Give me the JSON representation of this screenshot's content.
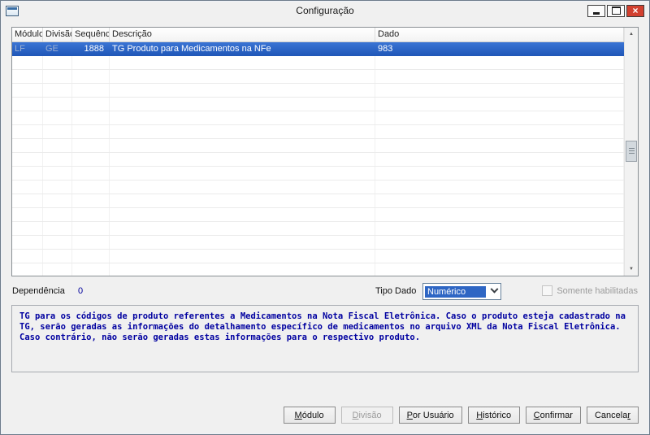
{
  "window": {
    "title": "Configuração",
    "close_glyph": "×"
  },
  "grid": {
    "columns": [
      "Módulo",
      "Divisão",
      "Sequência",
      "Descrição",
      "Dado"
    ],
    "selected_row": {
      "modulo": "LF",
      "divisao": "GE",
      "sequencia": "1888",
      "descricao": "TG Produto para Medicamentos na NFe",
      "dado": "983"
    },
    "empty_row_count": 16,
    "scrollbar": {
      "up_glyph": "▲",
      "down_glyph": "▼"
    }
  },
  "fields": {
    "dependencia_label": "Dependência",
    "dependencia_value": "0",
    "tipo_dado_label": "Tipo Dado",
    "tipo_dado_value": "Numérico",
    "somente_habilitadas_label": "Somente habilitadas"
  },
  "description": {
    "text": "TG para os códigos de produto referentes a Medicamentos na Nota Fiscal Eletrônica. Caso o produto esteja cadastrado na TG, serão geradas as informações do detalhamento específico de medicamentos no arquivo XML da Nota Fiscal Eletrônica. Caso contrário, não serão geradas estas informações para o respectivo produto."
  },
  "buttons": [
    {
      "pre": "",
      "key": "M",
      "post": "ódulo",
      "disabled": false
    },
    {
      "pre": "",
      "key": "D",
      "post": "ivisão",
      "disabled": true
    },
    {
      "pre": "",
      "key": "P",
      "post": "or Usuário",
      "disabled": false
    },
    {
      "pre": "",
      "key": "H",
      "post": "istórico",
      "disabled": false
    },
    {
      "pre": "",
      "key": "C",
      "post": "onfirmar",
      "disabled": false
    },
    {
      "pre": "Cancela",
      "key": "r",
      "post": "",
      "disabled": false
    }
  ],
  "colors": {
    "selection_blue": "#2158b9",
    "description_text": "#0000a0",
    "close_button_red": "#d2402f",
    "window_background": "#f0f0f0"
  }
}
